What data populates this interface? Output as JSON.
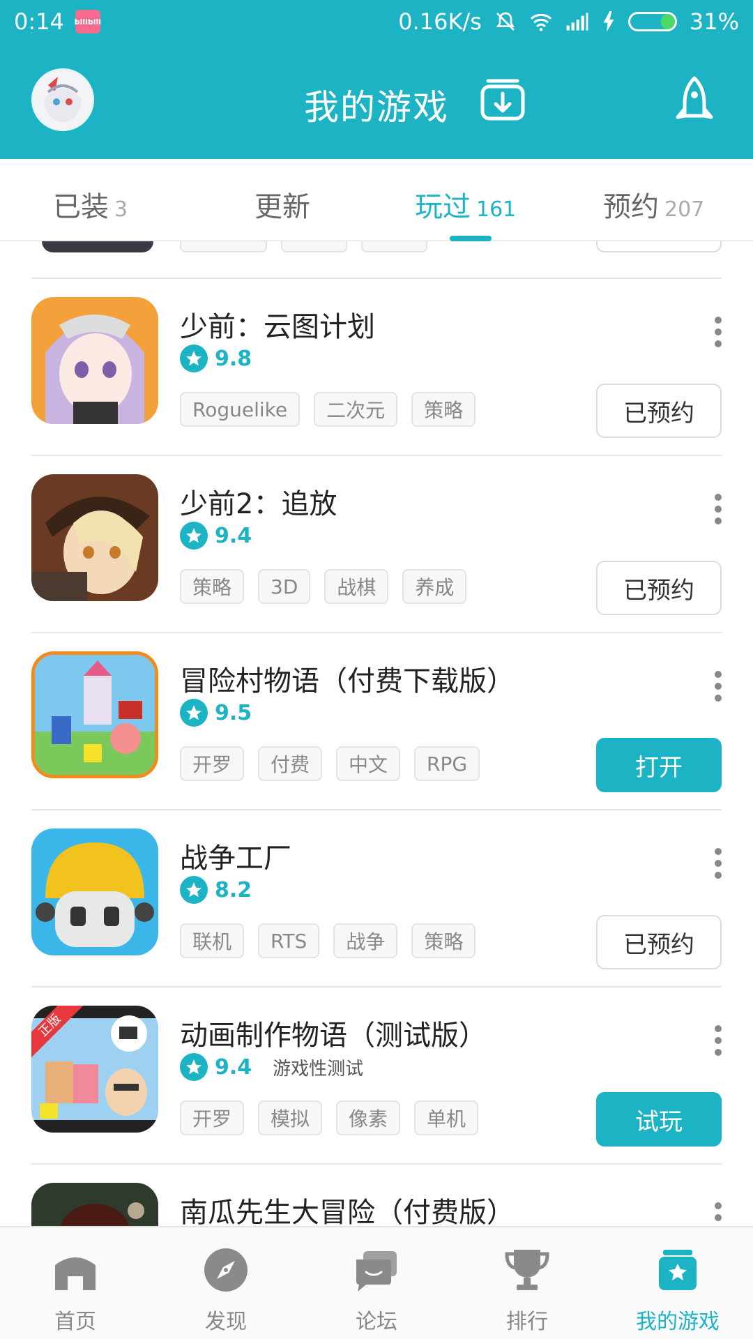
{
  "status_bar": {
    "time": "0:14",
    "app_badge": "bilibili",
    "net_speed": "0.16K/s",
    "battery": "31%",
    "battery_level": 0.31
  },
  "header": {
    "title": "我的游戏"
  },
  "tabs": [
    {
      "label": "已装",
      "count": "3"
    },
    {
      "label": "更新",
      "count": ""
    },
    {
      "label": "玩过",
      "count": "161"
    },
    {
      "label": "预约",
      "count": "207"
    }
  ],
  "games": [
    {
      "name": "少前：云图计划",
      "rating": "9.8",
      "note": "",
      "tags": [
        "Roguelike",
        "二次元",
        "策略"
      ],
      "action": "已预约"
    },
    {
      "name": "少前2：追放",
      "rating": "9.4",
      "note": "",
      "tags": [
        "策略",
        "3D",
        "战棋",
        "养成"
      ],
      "action": "已预约"
    },
    {
      "name": "冒险村物语（付费下载版）",
      "rating": "9.5",
      "note": "",
      "tags": [
        "开罗",
        "付费",
        "中文",
        "RPG"
      ],
      "action": "打开"
    },
    {
      "name": "战争工厂",
      "rating": "8.2",
      "note": "",
      "tags": [
        "联机",
        "RTS",
        "战争",
        "策略"
      ],
      "action": "已预约"
    },
    {
      "name": "动画制作物语（测试版）",
      "rating": "9.4",
      "note": "游戏性测试",
      "icon_ribbon": "正版",
      "tags": [
        "开罗",
        "模拟",
        "像素",
        "单机"
      ],
      "action": "试玩"
    },
    {
      "name": "南瓜先生大冒险（付费版）",
      "rating": "",
      "note": "",
      "tags": [],
      "action": ""
    }
  ],
  "bottom_nav": [
    {
      "label": "首页",
      "icon": "home-icon"
    },
    {
      "label": "发现",
      "icon": "compass-icon"
    },
    {
      "label": "论坛",
      "icon": "forum-icon"
    },
    {
      "label": "排行",
      "icon": "trophy-icon"
    },
    {
      "label": "我的游戏",
      "icon": "my-games-icon"
    }
  ],
  "colors": {
    "accent": "#1CB3C4",
    "text": "#333333",
    "tag_border": "#e4e4e4"
  }
}
